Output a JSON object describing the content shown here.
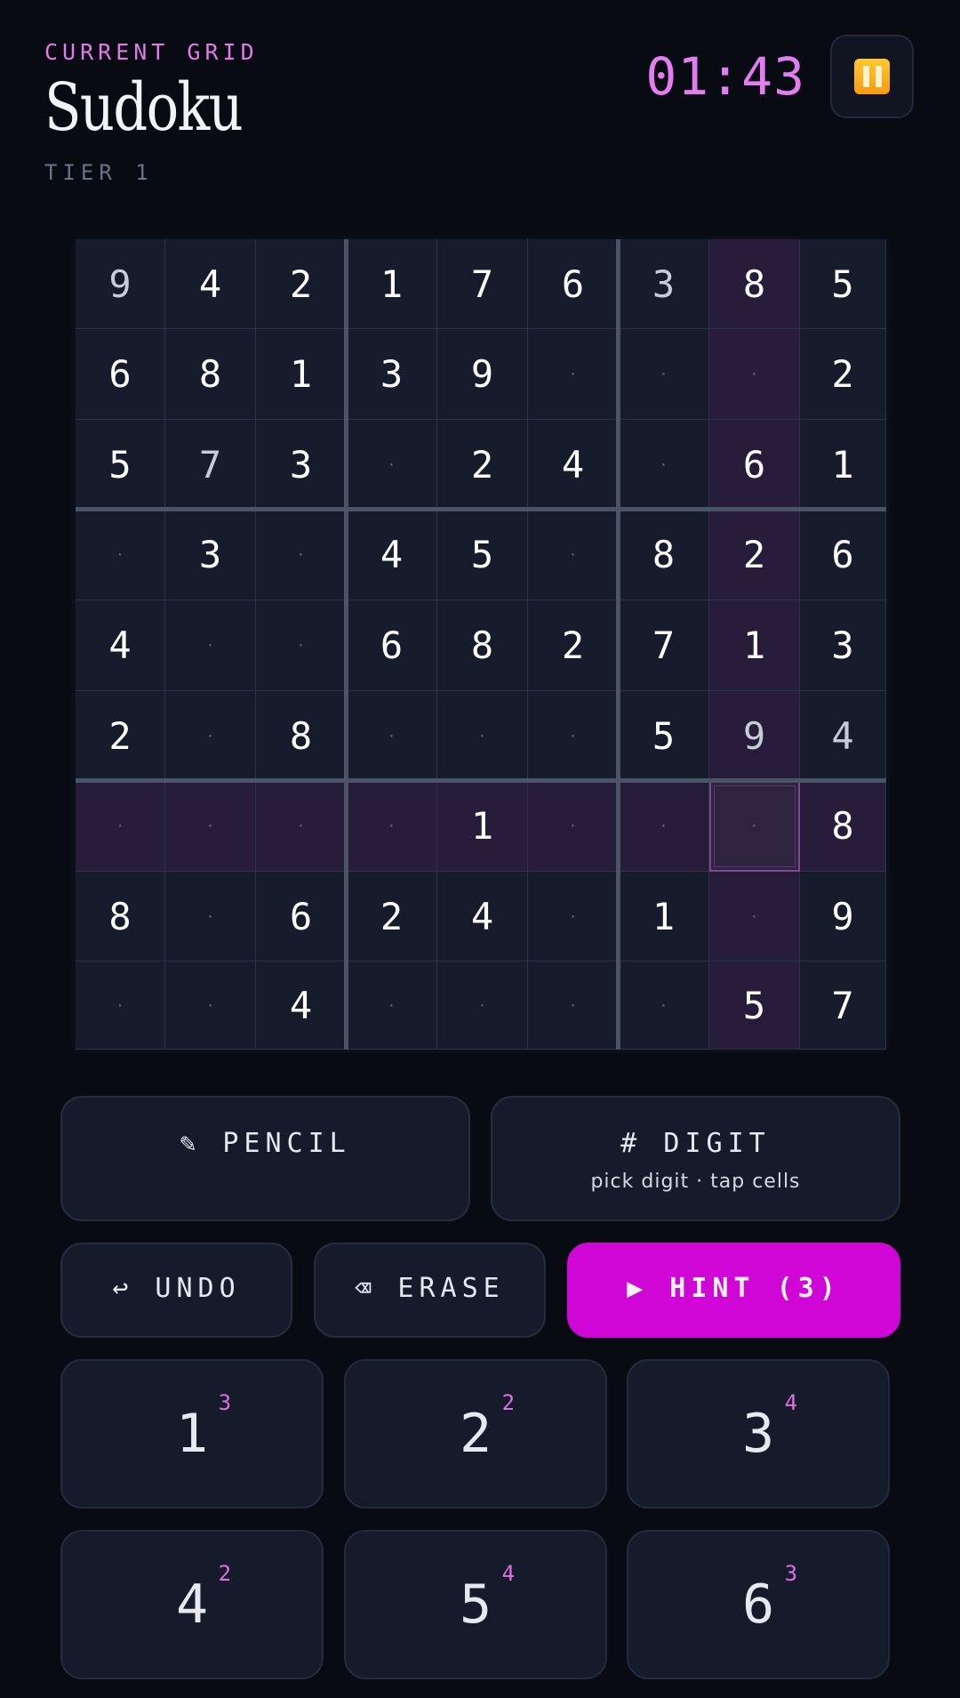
{
  "header": {
    "eyebrow": "CURRENT GRID",
    "title": "Sudoku",
    "tier": "TIER 1",
    "timer": "01:43",
    "pause_icon": "pause-icon"
  },
  "board": {
    "empty_glyph": "·",
    "selected": {
      "row": 6,
      "col": 7
    },
    "rows": [
      [
        "9",
        "4",
        "2",
        "1",
        "7",
        "6",
        "3",
        "8",
        "5"
      ],
      [
        "6",
        "8",
        "1",
        "3",
        "9",
        "",
        "",
        "",
        "2"
      ],
      [
        "5",
        "7",
        "3",
        "",
        "2",
        "4",
        "",
        "6",
        "1"
      ],
      [
        "",
        "3",
        "",
        "4",
        "5",
        "",
        "8",
        "2",
        "6"
      ],
      [
        "4",
        "",
        "",
        "6",
        "8",
        "2",
        "7",
        "1",
        "3"
      ],
      [
        "2",
        "",
        "8",
        "",
        "",
        "",
        "5",
        "9",
        "4"
      ],
      [
        "",
        "",
        "",
        "",
        "1",
        "",
        "",
        "",
        "8"
      ],
      [
        "8",
        "",
        "6",
        "2",
        "4",
        "",
        "1",
        "",
        "9"
      ],
      [
        "",
        "",
        "4",
        "",
        "",
        "",
        "",
        "5",
        "7"
      ]
    ],
    "dim_cells": [
      [
        0,
        0
      ],
      [
        0,
        6
      ],
      [
        2,
        1
      ],
      [
        5,
        7
      ],
      [
        5,
        8
      ]
    ]
  },
  "actions": {
    "pencil": {
      "label": "✎ PENCIL"
    },
    "digit": {
      "label": "# DIGIT",
      "sub": "pick digit · tap cells"
    },
    "undo": {
      "label": "↩ UNDO"
    },
    "erase": {
      "label": "⌫ ERASE"
    },
    "hint": {
      "label": "▶ HINT (3)"
    }
  },
  "numpad": [
    {
      "digit": "1",
      "count": "3"
    },
    {
      "digit": "2",
      "count": "2"
    },
    {
      "digit": "3",
      "count": "4"
    },
    {
      "digit": "4",
      "count": "2"
    },
    {
      "digit": "5",
      "count": "4"
    },
    {
      "digit": "6",
      "count": "3"
    }
  ],
  "colors": {
    "accent": "#e27ae8",
    "hint": "#d006d6",
    "highlight": "#271d3a"
  }
}
